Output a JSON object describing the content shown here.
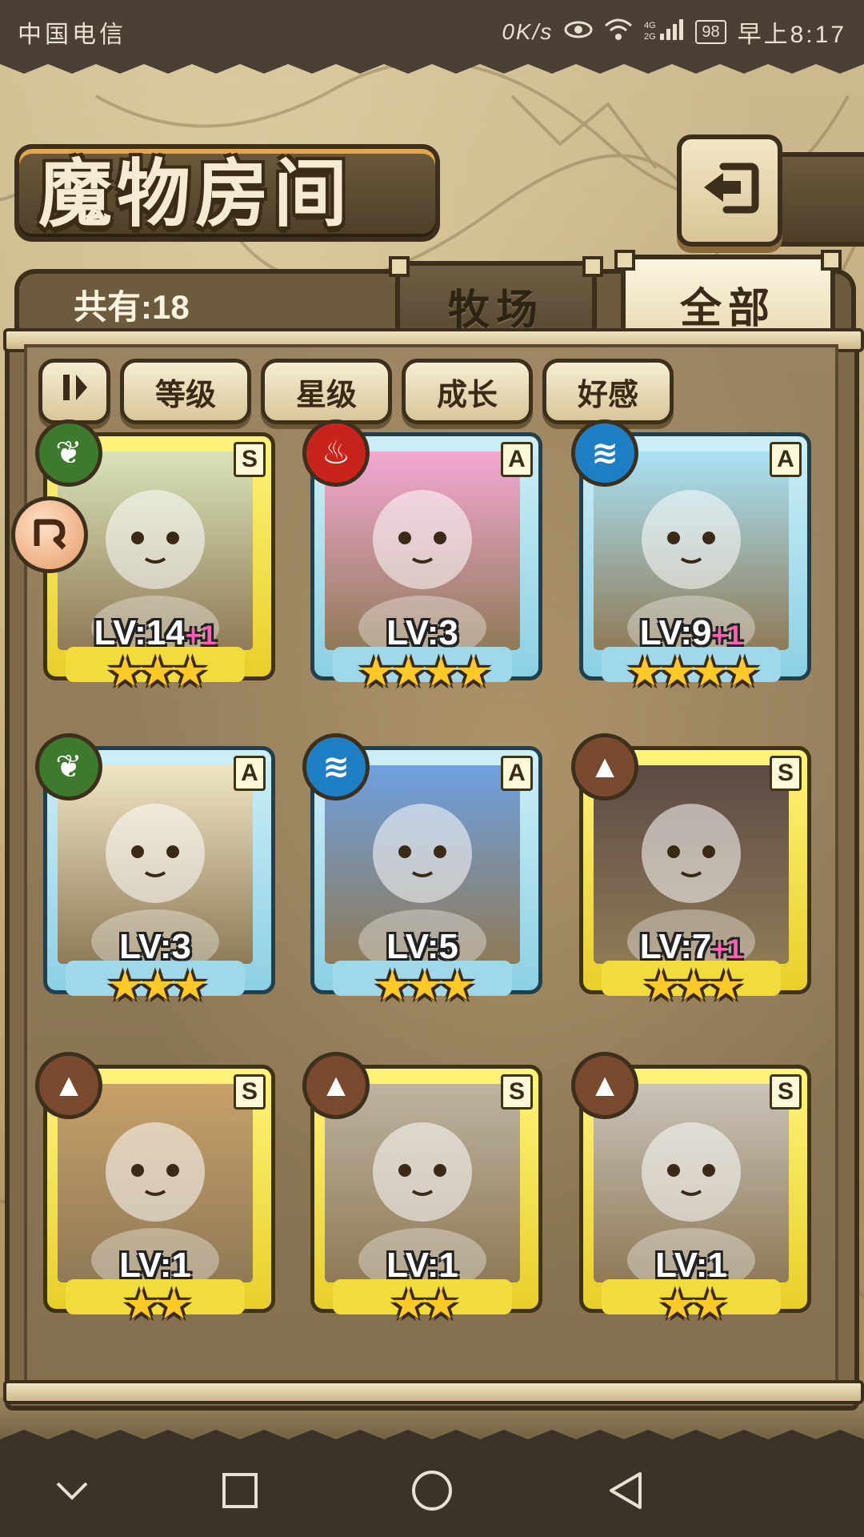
{
  "status_bar": {
    "carrier": "中国电信",
    "speed": "0K/s",
    "network": "4G 2G",
    "battery": "98",
    "time": "早上8:17"
  },
  "header": {
    "title": "魔物房间",
    "back_icon": "back-arrow-icon"
  },
  "summary": {
    "count_label": "共有:18"
  },
  "tabs": [
    {
      "label": "牧场",
      "selected": false
    },
    {
      "label": "全部",
      "selected": true
    }
  ],
  "sort_buttons": {
    "toggle_icon": "sort-order-icon",
    "items": [
      "等级",
      "星级",
      "成长",
      "好感"
    ]
  },
  "monsters": [
    {
      "rank": "S",
      "element": "leaf",
      "element_color": "#3e7a2e",
      "frame": "gold",
      "level": "LV:14",
      "bonus": "+1",
      "stars": "★★★",
      "portrait_color": "#d9e3b8"
    },
    {
      "rank": "A",
      "element": "fire",
      "element_color": "#c8241c",
      "frame": "blue",
      "level": "LV:3",
      "bonus": "",
      "stars": "★★★★",
      "portrait_color": "#f4a7d3"
    },
    {
      "rank": "A",
      "element": "water",
      "element_color": "#1f7fc4",
      "frame": "blue",
      "level": "LV:9",
      "bonus": "+1",
      "stars": "★★★★",
      "portrait_color": "#a9e2f5"
    },
    {
      "rank": "A",
      "element": "leaf",
      "element_color": "#3e7a2e",
      "frame": "blue",
      "level": "LV:3",
      "bonus": "",
      "stars": "★★★",
      "portrait_color": "#efe5c4"
    },
    {
      "rank": "A",
      "element": "water",
      "element_color": "#1f7fc4",
      "frame": "blue",
      "level": "LV:5",
      "bonus": "",
      "stars": "★★★",
      "portrait_color": "#6ea0e0"
    },
    {
      "rank": "S",
      "element": "earth",
      "element_color": "#7a4a2e",
      "frame": "gold",
      "level": "LV:7",
      "bonus": "+1",
      "stars": "★★★",
      "portrait_color": "#5b4a45"
    },
    {
      "rank": "S",
      "element": "earth",
      "element_color": "#7a4a2e",
      "frame": "gold",
      "level": "LV:1",
      "bonus": "",
      "stars": "★★",
      "portrait_color": "#c7a06a"
    },
    {
      "rank": "S",
      "element": "earth",
      "element_color": "#7a4a2e",
      "frame": "gold",
      "level": "LV:1",
      "bonus": "",
      "stars": "★★",
      "portrait_color": "#bdb3a0"
    },
    {
      "rank": "S",
      "element": "earth",
      "element_color": "#7a4a2e",
      "frame": "gold",
      "level": "LV:1",
      "bonus": "",
      "stars": "★★",
      "portrait_color": "#c9c3ba"
    }
  ],
  "side_badge_icon": "arrow-marker-icon",
  "nav_bar": {
    "icons": [
      "hide-keyboard-icon",
      "recent-apps-icon",
      "home-icon",
      "back-icon"
    ]
  }
}
